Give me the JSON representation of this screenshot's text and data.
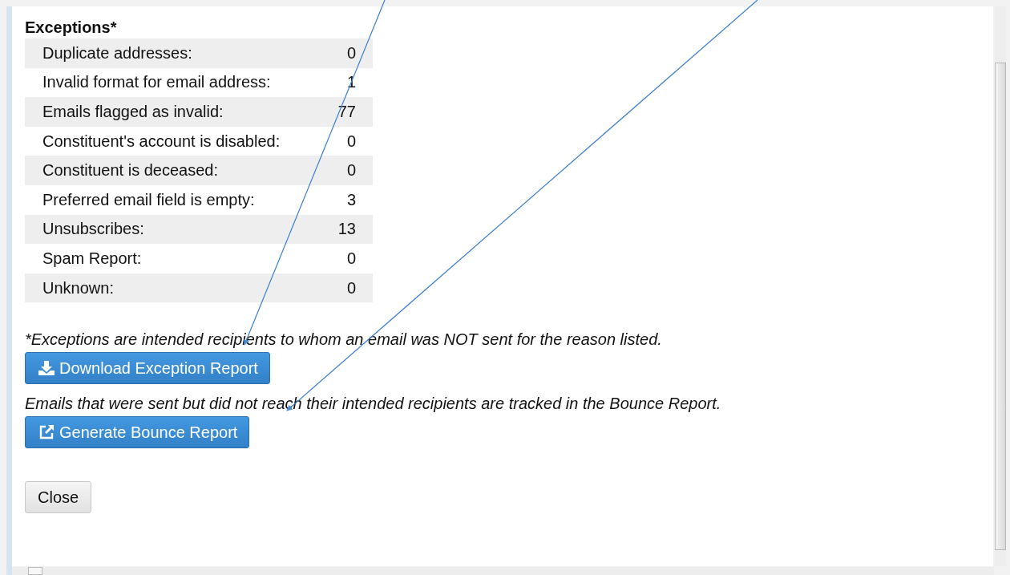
{
  "exceptions": {
    "title": "Exceptions*",
    "rows": [
      {
        "label": "Duplicate addresses:",
        "value": "0"
      },
      {
        "label": "Invalid format for email address:",
        "value": "1"
      },
      {
        "label": "Emails flagged as invalid:",
        "value": "77"
      },
      {
        "label": "Constituent's account is disabled:",
        "value": "0"
      },
      {
        "label": "Constituent is deceased:",
        "value": "0"
      },
      {
        "label": "Preferred email field is empty:",
        "value": "3"
      },
      {
        "label": "Unsubscribes:",
        "value": "13"
      },
      {
        "label": "Spam Report:",
        "value": "0"
      },
      {
        "label": "Unknown:",
        "value": "0"
      }
    ],
    "footnote": "*Exceptions are intended recipients to whom an email was NOT sent for the reason listed.",
    "download_button": "Download Exception Report",
    "bounce_note": "Emails that were sent but did not reach their intended recipients are tracked in the Bounce Report.",
    "bounce_button": "Generate Bounce Report"
  },
  "close_button": "Close"
}
